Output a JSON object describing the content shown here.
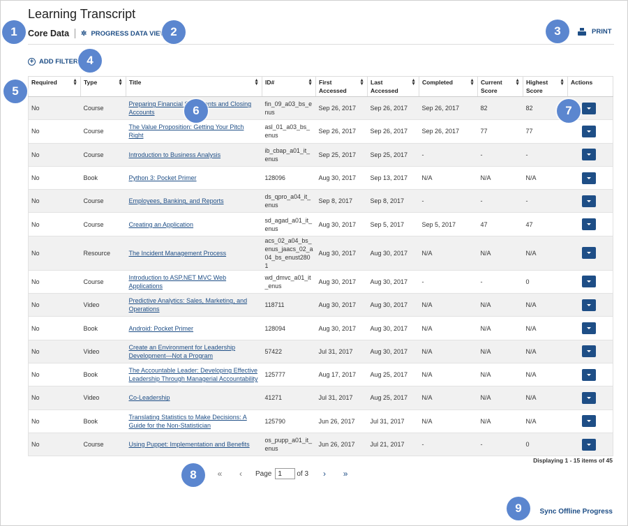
{
  "page": {
    "title": "Learning Transcript"
  },
  "tabs": {
    "core": "Core Data",
    "progress": "PROGRESS DATA VIEW"
  },
  "toolbar": {
    "print": "PRINT",
    "add_filters": "ADD FILTERS"
  },
  "table": {
    "columns": [
      "Required",
      "Type",
      "Title",
      "ID#",
      "First Accessed",
      "Last Accessed",
      "Completed",
      "Current Score",
      "Highest Score",
      "Actions"
    ],
    "rows": [
      {
        "required": "No",
        "type": "Course",
        "title": "Preparing Financial Statements and Closing Accounts",
        "id": "fin_09_a03_bs_enus",
        "first": "Sep 26, 2017",
        "last": "Sep 26, 2017",
        "completed": "Sep 26, 2017",
        "current": "82",
        "highest": "82"
      },
      {
        "required": "No",
        "type": "Course",
        "title": "The Value Proposition: Getting Your Pitch Right",
        "id": "asl_01_a03_bs_enus",
        "first": "Sep 26, 2017",
        "last": "Sep 26, 2017",
        "completed": "Sep 26, 2017",
        "current": "77",
        "highest": "77"
      },
      {
        "required": "No",
        "type": "Course",
        "title": "Introduction to Business Analysis",
        "id": "ib_cbap_a01_it_enus",
        "first": "Sep 25, 2017",
        "last": "Sep 25, 2017",
        "completed": "-",
        "current": "-",
        "highest": "-"
      },
      {
        "required": "No",
        "type": "Book",
        "title": "Python 3: Pocket Primer",
        "id": "128096",
        "first": "Aug 30, 2017",
        "last": "Sep 13, 2017",
        "completed": "N/A",
        "current": "N/A",
        "highest": "N/A"
      },
      {
        "required": "No",
        "type": "Course",
        "title": "Employees, Banking, and Reports",
        "id": "ds_qpro_a04_it_enus",
        "first": "Sep 8, 2017",
        "last": "Sep 8, 2017",
        "completed": "-",
        "current": "-",
        "highest": "-"
      },
      {
        "required": "No",
        "type": "Course",
        "title": "Creating an Application",
        "id": "sd_agad_a01_it_enus",
        "first": "Aug 30, 2017",
        "last": "Sep 5, 2017",
        "completed": "Sep 5, 2017",
        "current": "47",
        "highest": "47"
      },
      {
        "required": "No",
        "type": "Resource",
        "title": "The Incident Management Process",
        "id": "acs_02_a04_bs_enus_jaacs_02_a04_bs_enust2801",
        "first": "Aug 30, 2017",
        "last": "Aug 30, 2017",
        "completed": "N/A",
        "current": "N/A",
        "highest": "N/A"
      },
      {
        "required": "No",
        "type": "Course",
        "title": "Introduction to ASP.NET MVC Web Applications",
        "id": "wd_dmvc_a01_it_enus",
        "first": "Aug 30, 2017",
        "last": "Aug 30, 2017",
        "completed": "-",
        "current": "-",
        "highest": "0"
      },
      {
        "required": "No",
        "type": "Video",
        "title": "Predictive Analytics: Sales, Marketing, and Operations",
        "id": "118711",
        "first": "Aug 30, 2017",
        "last": "Aug 30, 2017",
        "completed": "N/A",
        "current": "N/A",
        "highest": "N/A"
      },
      {
        "required": "No",
        "type": "Book",
        "title": "Android: Pocket Primer",
        "id": "128094",
        "first": "Aug 30, 2017",
        "last": "Aug 30, 2017",
        "completed": "N/A",
        "current": "N/A",
        "highest": "N/A"
      },
      {
        "required": "No",
        "type": "Video",
        "title": "Create an Environment for Leadership Development—Not a Program",
        "id": "57422",
        "first": "Jul 31, 2017",
        "last": "Aug 30, 2017",
        "completed": "N/A",
        "current": "N/A",
        "highest": "N/A"
      },
      {
        "required": "No",
        "type": "Book",
        "title": "The Accountable Leader: Developing Effective Leadership Through Managerial Accountability",
        "id": "125777",
        "first": "Aug 17, 2017",
        "last": "Aug 25, 2017",
        "completed": "N/A",
        "current": "N/A",
        "highest": "N/A"
      },
      {
        "required": "No",
        "type": "Video",
        "title": "Co-Leadership",
        "id": "41271",
        "first": "Jul 31, 2017",
        "last": "Aug 25, 2017",
        "completed": "N/A",
        "current": "N/A",
        "highest": "N/A"
      },
      {
        "required": "No",
        "type": "Book",
        "title": "Translating Statistics to Make Decisions: A Guide for the Non-Statistician",
        "id": "125790",
        "first": "Jun 26, 2017",
        "last": "Jul 31, 2017",
        "completed": "N/A",
        "current": "N/A",
        "highest": "N/A"
      },
      {
        "required": "No",
        "type": "Course",
        "title": "Using Puppet: Implementation and Benefits",
        "id": "os_pupp_a01_it_enus",
        "first": "Jun 26, 2017",
        "last": "Jul 21, 2017",
        "completed": "-",
        "current": "-",
        "highest": "0"
      }
    ]
  },
  "footer": {
    "displaying": "Displaying 1 - 15 items of 45",
    "page_label": "Page",
    "page_value": "1",
    "of_label": "of 3",
    "sync": "Sync Offline Progress"
  },
  "callouts": [
    "1",
    "2",
    "3",
    "4",
    "5",
    "6",
    "7",
    "8",
    "9"
  ],
  "colors": {
    "accent": "#1e4e86",
    "callout": "#5b86cf",
    "row_alt": "#f1f1f1"
  },
  "icons": {
    "progress": "gear-icon",
    "print": "printer-icon",
    "filters": "plus-circle-icon",
    "sort": "sort-icon",
    "action": "caret-down-icon"
  }
}
